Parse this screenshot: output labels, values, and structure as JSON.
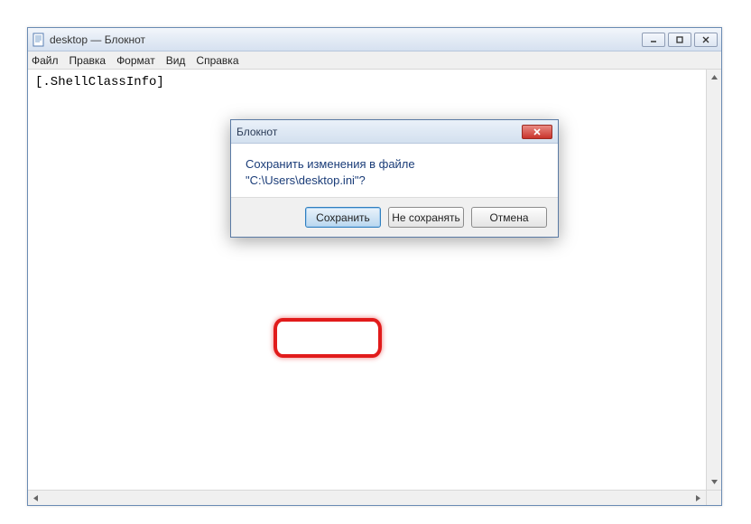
{
  "mainWindow": {
    "title": "desktop — Блокнот",
    "menu": {
      "file": "Файл",
      "edit": "Правка",
      "format": "Формат",
      "view": "Вид",
      "help": "Справка"
    },
    "content": "[.ShellClassInfo]"
  },
  "dialog": {
    "title": "Блокнот",
    "messageLine1": "Сохранить изменения в файле",
    "messageLine2": "\"C:\\Users\\desktop.ini\"?",
    "buttons": {
      "save": "Сохранить",
      "dontSave": "Не сохранять",
      "cancel": "Отмена"
    }
  }
}
